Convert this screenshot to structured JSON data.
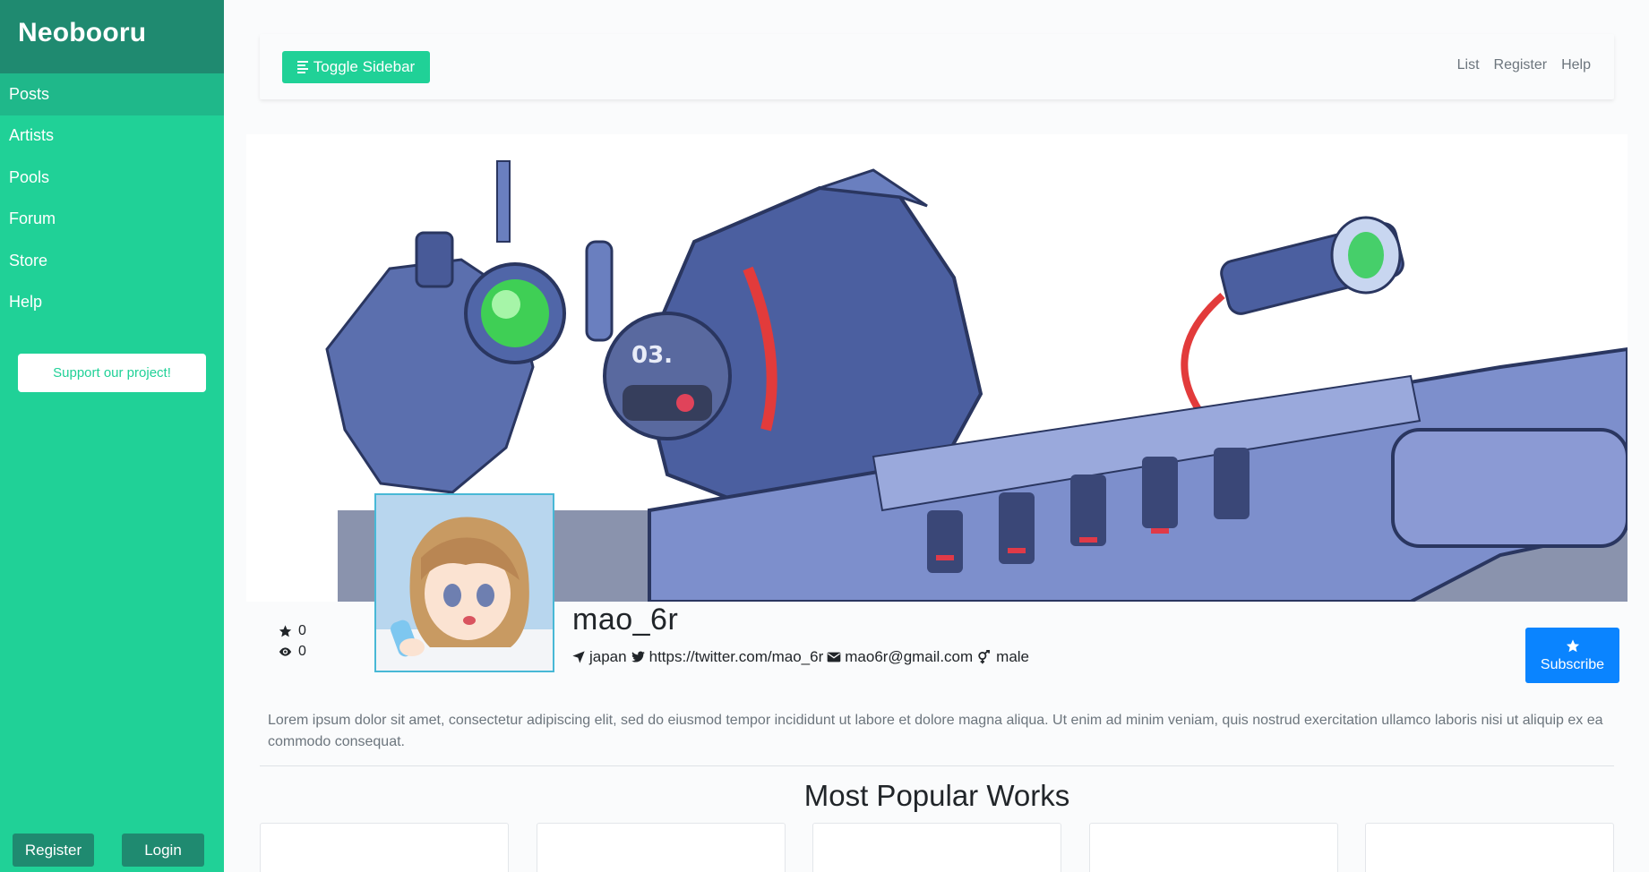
{
  "brand": "Neobooru",
  "sidebar": {
    "items": [
      {
        "label": "Posts",
        "active": true
      },
      {
        "label": "Artists",
        "active": false
      },
      {
        "label": "Pools",
        "active": false
      },
      {
        "label": "Forum",
        "active": false
      },
      {
        "label": "Store",
        "active": false
      },
      {
        "label": "Help",
        "active": false
      }
    ],
    "support_label": "Support our project!",
    "register_label": "Register",
    "login_label": "Login"
  },
  "topbar": {
    "toggle_label": "Toggle Sidebar",
    "links": [
      "List",
      "Register",
      "Help"
    ]
  },
  "profile": {
    "username": "mao_6r",
    "favorites_count": "0",
    "views_count": "0",
    "location": "japan",
    "twitter": "https://twitter.com/mao_6r",
    "email": "mao6r@gmail.com",
    "gender": "male",
    "subscribe_label": "Subscribe",
    "bio": "Lorem ipsum dolor sit amet, consectetur adipiscing elit, sed do eiusmod tempor incididunt ut labore et dolore magna aliqua. Ut enim ad minim veniam, quis nostrud exercitation ullamco laboris nisi ut aliquip ex ea commodo consequat."
  },
  "popular": {
    "title": "Most Popular Works"
  },
  "colors": {
    "sidebar": "#20d197",
    "brand_bg": "#1f8a70",
    "active_item": "#1fb88a",
    "subscribe": "#0a84ff"
  },
  "icons": [
    "hamburger-icon",
    "star-icon",
    "eye-icon",
    "location-arrow-icon",
    "twitter-icon",
    "envelope-icon",
    "gender-icon"
  ]
}
